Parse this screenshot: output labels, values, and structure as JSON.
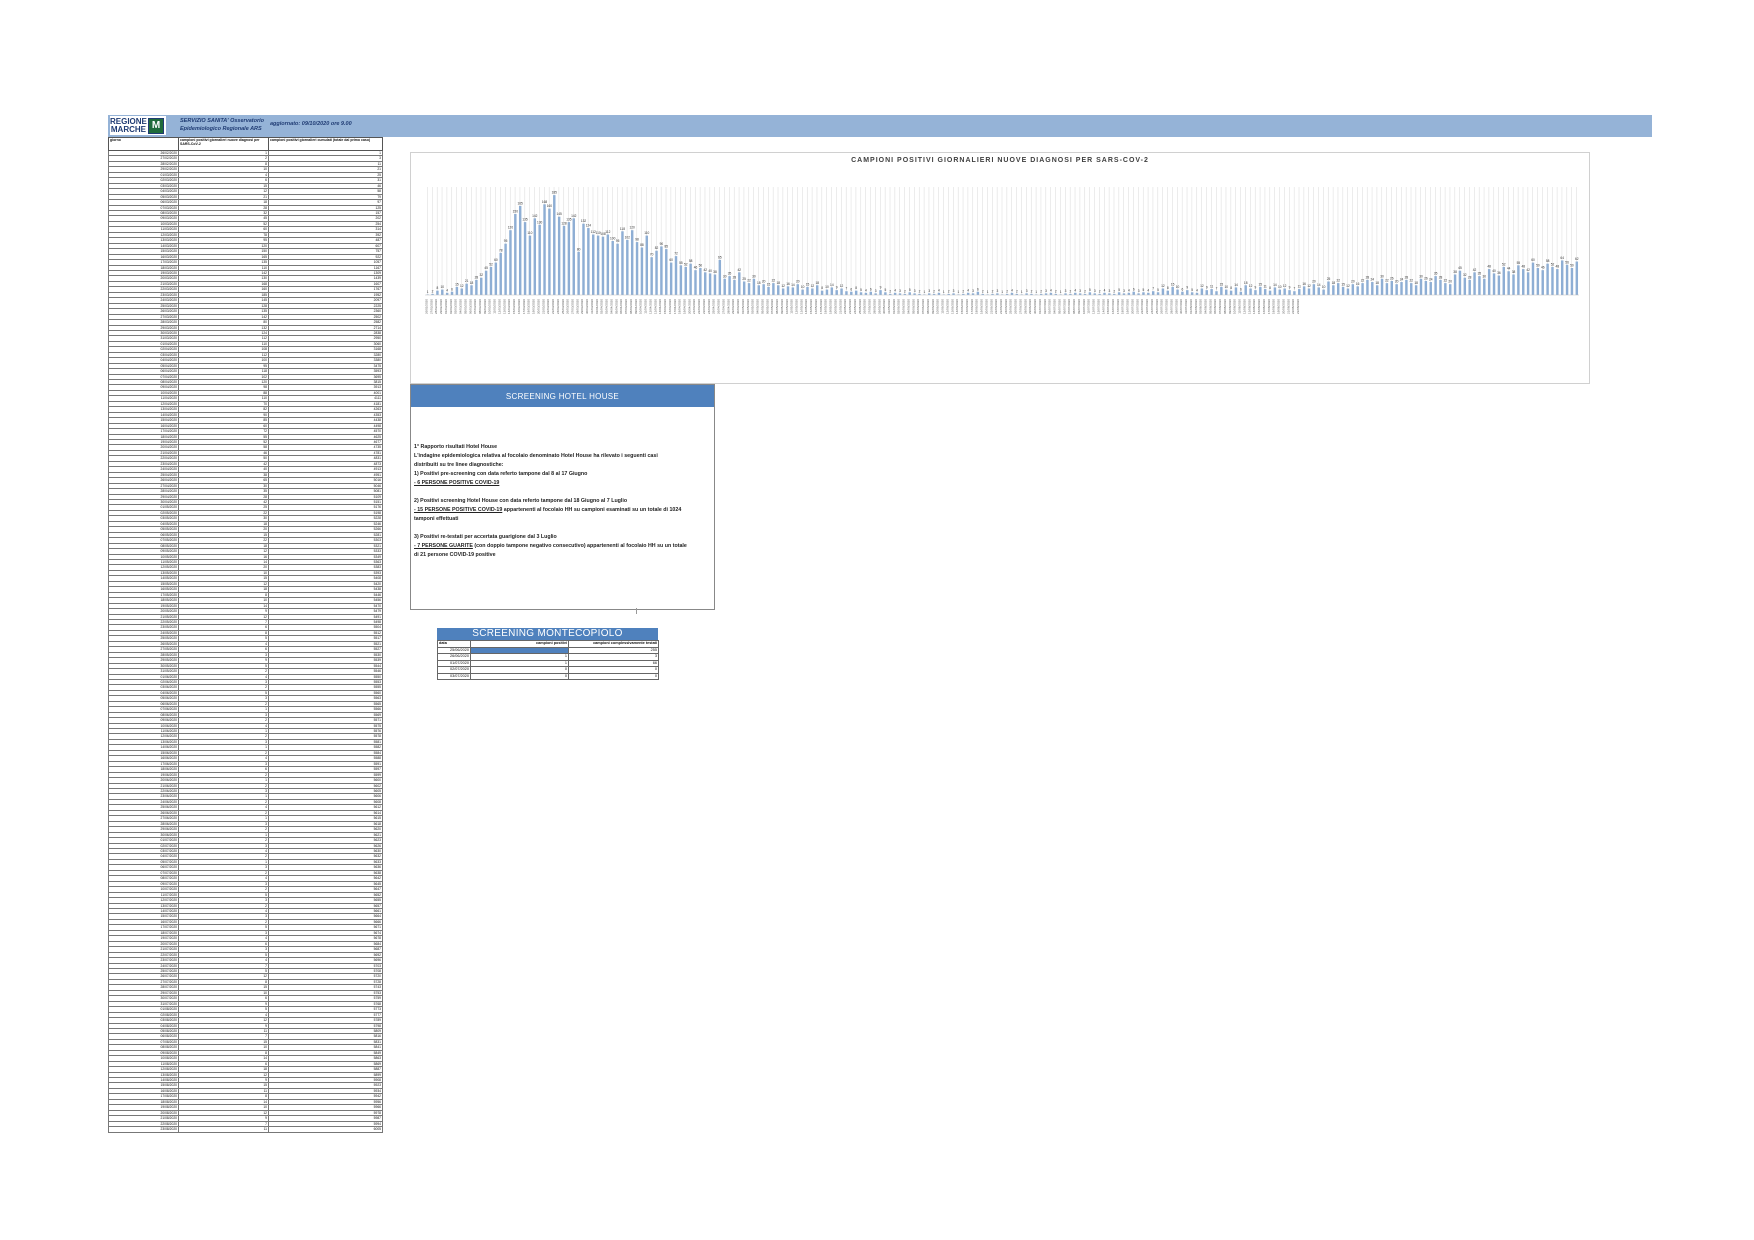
{
  "header": {
    "logo_text": "REGIONE MARCHE",
    "logo_mark": "M",
    "office": "SERVIZIO SANITA' Osservatorio Epidemiologico Regionale ARS",
    "update": "aggiornato: 09/10/2020 ore 9.00"
  },
  "table": {
    "headers": [
      "giorno",
      "campioni positivi giornalieri nuove diagnosi per SARS-CoV-2",
      "campioni positivi giornalieri cumulati (totale dal primo caso)"
    ],
    "rows": [
      [
        "26/02/2020",
        "1",
        "1"
      ],
      [
        "27/02/2020",
        "2",
        "3"
      ],
      [
        "28/02/2020",
        "8",
        "11"
      ],
      [
        "29/02/2020",
        "10",
        "21"
      ],
      [
        "01/03/2020",
        "4",
        "25"
      ],
      [
        "02/03/2020",
        "6",
        "31"
      ],
      [
        "03/03/2020",
        "15",
        "46"
      ],
      [
        "04/03/2020",
        "12",
        "58"
      ],
      [
        "05/03/2020",
        "21",
        "79"
      ],
      [
        "06/03/2020",
        "18",
        "97"
      ],
      [
        "07/03/2020",
        "28",
        "125"
      ],
      [
        "08/03/2020",
        "32",
        "157"
      ],
      [
        "09/03/2020",
        "45",
        "202"
      ],
      [
        "10/03/2020",
        "52",
        "254"
      ],
      [
        "11/03/2020",
        "60",
        "314"
      ],
      [
        "12/03/2020",
        "78",
        "392"
      ],
      [
        "13/03/2020",
        "95",
        "487"
      ],
      [
        "14/03/2020",
        "120",
        "607"
      ],
      [
        "15/03/2020",
        "150",
        "757"
      ],
      [
        "16/03/2020",
        "165",
        "922"
      ],
      [
        "17/03/2020",
        "135",
        "1057"
      ],
      [
        "18/03/2020",
        "110",
        "1167"
      ],
      [
        "19/03/2020",
        "142",
        "1309"
      ],
      [
        "20/03/2020",
        "130",
        "1439"
      ],
      [
        "21/03/2020",
        "168",
        "1607"
      ],
      [
        "22/03/2020",
        "160",
        "1767"
      ],
      [
        "23/03/2020",
        "185",
        "1952"
      ],
      [
        "24/03/2020",
        "145",
        "2097"
      ],
      [
        "25/03/2020",
        "128",
        "2225"
      ],
      [
        "26/03/2020",
        "135",
        "2360"
      ],
      [
        "27/03/2020",
        "142",
        "2502"
      ],
      [
        "28/03/2020",
        "80",
        "2582"
      ],
      [
        "29/03/2020",
        "132",
        "2714"
      ],
      [
        "30/03/2020",
        "124",
        "2838"
      ],
      [
        "31/03/2020",
        "112",
        "2950"
      ],
      [
        "01/04/2020",
        "110",
        "3060"
      ],
      [
        "02/04/2020",
        "108",
        "3168"
      ],
      [
        "03/04/2020",
        "112",
        "3280"
      ],
      [
        "04/04/2020",
        "100",
        "3380"
      ],
      [
        "05/04/2020",
        "95",
        "3475"
      ],
      [
        "06/04/2020",
        "118",
        "3593"
      ],
      [
        "07/04/2020",
        "102",
        "3695"
      ],
      [
        "08/04/2020",
        "120",
        "3815"
      ],
      [
        "09/04/2020",
        "98",
        "3913"
      ],
      [
        "10/04/2020",
        "88",
        "4001"
      ],
      [
        "11/04/2020",
        "110",
        "4111"
      ],
      [
        "12/04/2020",
        "70",
        "4181"
      ],
      [
        "13/04/2020",
        "82",
        "4263"
      ],
      [
        "14/04/2020",
        "90",
        "4353"
      ],
      [
        "15/04/2020",
        "85",
        "4438"
      ],
      [
        "16/04/2020",
        "60",
        "4498"
      ],
      [
        "17/04/2020",
        "72",
        "4570"
      ],
      [
        "18/04/2020",
        "55",
        "4625"
      ],
      [
        "19/04/2020",
        "52",
        "4677"
      ],
      [
        "20/04/2020",
        "58",
        "4735"
      ],
      [
        "21/04/2020",
        "46",
        "4781"
      ],
      [
        "22/04/2020",
        "50",
        "4831"
      ],
      [
        "23/04/2020",
        "42",
        "4873"
      ],
      [
        "24/04/2020",
        "40",
        "4913"
      ],
      [
        "25/04/2020",
        "38",
        "4951"
      ],
      [
        "26/04/2020",
        "65",
        "5016"
      ],
      [
        "27/04/2020",
        "30",
        "5046"
      ],
      [
        "28/04/2020",
        "35",
        "5081"
      ],
      [
        "29/04/2020",
        "28",
        "5109"
      ],
      [
        "30/04/2020",
        "42",
        "5151"
      ],
      [
        "01/05/2020",
        "25",
        "5176"
      ],
      [
        "02/05/2020",
        "22",
        "5198"
      ],
      [
        "03/05/2020",
        "30",
        "5228"
      ],
      [
        "04/05/2020",
        "18",
        "5246"
      ],
      [
        "05/05/2020",
        "20",
        "5266"
      ],
      [
        "06/05/2020",
        "15",
        "5281"
      ],
      [
        "07/05/2020",
        "22",
        "5303"
      ],
      [
        "08/05/2020",
        "18",
        "5321"
      ],
      [
        "09/05/2020",
        "12",
        "5333"
      ],
      [
        "10/05/2020",
        "16",
        "5349"
      ],
      [
        "11/05/2020",
        "14",
        "5363"
      ],
      [
        "12/05/2020",
        "20",
        "5383"
      ],
      [
        "13/05/2020",
        "10",
        "5393"
      ],
      [
        "14/05/2020",
        "15",
        "5408"
      ],
      [
        "15/05/2020",
        "12",
        "5420"
      ],
      [
        "16/05/2020",
        "18",
        "5438"
      ],
      [
        "17/05/2020",
        "8",
        "5446"
      ],
      [
        "18/05/2020",
        "10",
        "5456"
      ],
      [
        "19/05/2020",
        "14",
        "5470"
      ],
      [
        "20/05/2020",
        "9",
        "5479"
      ],
      [
        "21/05/2020",
        "12",
        "5491"
      ],
      [
        "22/05/2020",
        "7",
        "5498"
      ],
      [
        "23/05/2020",
        "6",
        "5504"
      ],
      [
        "24/05/2020",
        "8",
        "5512"
      ],
      [
        "25/05/2020",
        "5",
        "5517"
      ],
      [
        "26/05/2020",
        "4",
        "5521"
      ],
      [
        "27/05/2020",
        "6",
        "5527"
      ],
      [
        "28/05/2020",
        "3",
        "5530"
      ],
      [
        "29/05/2020",
        "9",
        "5539"
      ],
      [
        "30/05/2020",
        "5",
        "5544"
      ],
      [
        "31/05/2020",
        "2",
        "5546"
      ],
      [
        "01/06/2020",
        "4",
        "5550"
      ],
      [
        "02/06/2020",
        "3",
        "5553"
      ],
      [
        "03/06/2020",
        "2",
        "5555"
      ],
      [
        "04/06/2020",
        "5",
        "5560"
      ],
      [
        "05/06/2020",
        "3",
        "5563"
      ],
      [
        "06/06/2020",
        "2",
        "5565"
      ],
      [
        "07/06/2020",
        "1",
        "5566"
      ],
      [
        "08/06/2020",
        "3",
        "5569"
      ],
      [
        "09/06/2020",
        "2",
        "5571"
      ],
      [
        "10/06/2020",
        "4",
        "5575"
      ],
      [
        "11/06/2020",
        "1",
        "5576"
      ],
      [
        "12/06/2020",
        "2",
        "5578"
      ],
      [
        "13/06/2020",
        "3",
        "5581"
      ],
      [
        "14/06/2020",
        "1",
        "5582"
      ],
      [
        "15/06/2020",
        "2",
        "5584"
      ],
      [
        "16/06/2020",
        "4",
        "5588"
      ],
      [
        "17/06/2020",
        "3",
        "5591"
      ],
      [
        "18/06/2020",
        "6",
        "5597"
      ],
      [
        "19/06/2020",
        "2",
        "5599"
      ],
      [
        "20/06/2020",
        "1",
        "5600"
      ],
      [
        "21/06/2020",
        "2",
        "5602"
      ],
      [
        "22/06/2020",
        "3",
        "5605"
      ],
      [
        "23/06/2020",
        "1",
        "5606"
      ],
      [
        "24/06/2020",
        "2",
        "5608"
      ],
      [
        "25/06/2020",
        "4",
        "5612"
      ],
      [
        "26/06/2020",
        "2",
        "5614"
      ],
      [
        "27/06/2020",
        "1",
        "5615"
      ],
      [
        "28/06/2020",
        "3",
        "5618"
      ],
      [
        "29/06/2020",
        "2",
        "5620"
      ],
      [
        "30/06/2020",
        "1",
        "5621"
      ],
      [
        "01/07/2020",
        "2",
        "5623"
      ],
      [
        "02/07/2020",
        "3",
        "5626"
      ],
      [
        "03/07/2020",
        "4",
        "5630"
      ],
      [
        "04/07/2020",
        "2",
        "5632"
      ],
      [
        "05/07/2020",
        "1",
        "5633"
      ],
      [
        "06/07/2020",
        "3",
        "5636"
      ],
      [
        "07/07/2020",
        "2",
        "5638"
      ],
      [
        "08/07/2020",
        "4",
        "5642"
      ],
      [
        "09/07/2020",
        "3",
        "5645"
      ],
      [
        "10/07/2020",
        "2",
        "5647"
      ],
      [
        "11/07/2020",
        "5",
        "5652"
      ],
      [
        "12/07/2020",
        "3",
        "5655"
      ],
      [
        "13/07/2020",
        "2",
        "5657"
      ],
      [
        "14/07/2020",
        "4",
        "5661"
      ],
      [
        "15/07/2020",
        "3",
        "5664"
      ],
      [
        "16/07/2020",
        "2",
        "5666"
      ],
      [
        "17/07/2020",
        "5",
        "5671"
      ],
      [
        "18/07/2020",
        "3",
        "5674"
      ],
      [
        "19/07/2020",
        "4",
        "5678"
      ],
      [
        "20/07/2020",
        "6",
        "5684"
      ],
      [
        "21/07/2020",
        "3",
        "5687"
      ],
      [
        "22/07/2020",
        "5",
        "5692"
      ],
      [
        "23/07/2020",
        "4",
        "5696"
      ],
      [
        "24/07/2020",
        "7",
        "5703"
      ],
      [
        "25/07/2020",
        "5",
        "5708"
      ],
      [
        "26/07/2020",
        "12",
        "5720"
      ],
      [
        "27/07/2020",
        "8",
        "5728"
      ],
      [
        "28/07/2020",
        "15",
        "5743"
      ],
      [
        "29/07/2020",
        "10",
        "5753"
      ],
      [
        "30/07/2020",
        "6",
        "5759"
      ],
      [
        "31/07/2020",
        "9",
        "5768"
      ],
      [
        "01/08/2020",
        "5",
        "5773"
      ],
      [
        "02/08/2020",
        "4",
        "5777"
      ],
      [
        "03/08/2020",
        "12",
        "5789"
      ],
      [
        "04/08/2020",
        "9",
        "5798"
      ],
      [
        "05/08/2020",
        "11",
        "5809"
      ],
      [
        "06/08/2020",
        "7",
        "5816"
      ],
      [
        "07/08/2020",
        "15",
        "5831"
      ],
      [
        "08/08/2020",
        "10",
        "5841"
      ],
      [
        "09/08/2020",
        "8",
        "5849"
      ],
      [
        "10/08/2020",
        "14",
        "5863"
      ],
      [
        "11/08/2020",
        "6",
        "5869"
      ],
      [
        "12/08/2020",
        "18",
        "5887"
      ],
      [
        "13/08/2020",
        "12",
        "5899"
      ],
      [
        "14/08/2020",
        "9",
        "5908"
      ],
      [
        "15/08/2020",
        "15",
        "5923"
      ],
      [
        "16/08/2020",
        "11",
        "5934"
      ],
      [
        "17/08/2020",
        "8",
        "5942"
      ],
      [
        "18/08/2020",
        "14",
        "5956"
      ],
      [
        "19/08/2020",
        "10",
        "5966"
      ],
      [
        "20/08/2020",
        "12",
        "5978"
      ],
      [
        "21/08/2020",
        "9",
        "5987"
      ],
      [
        "22/08/2020",
        "7",
        "5994"
      ],
      [
        "23/08/2020",
        "11",
        "6005"
      ]
    ]
  },
  "chart_data": {
    "type": "bar",
    "title": "CAMPIONI POSITIVI GIORNALIERI NUOVE DIAGNOSI PER SARS-COV-2",
    "ylim": [
      0,
      200
    ],
    "grid": true,
    "series": [
      {
        "values": [
          1,
          2,
          8,
          10,
          4,
          6,
          15,
          12,
          21,
          18,
          28,
          32,
          45,
          52,
          60,
          78,
          95,
          120,
          150,
          165,
          135,
          110,
          142,
          130,
          168,
          160,
          185,
          145,
          128,
          135,
          142,
          80,
          132,
          124,
          112,
          110,
          108,
          112,
          100,
          95,
          118,
          102,
          120,
          98,
          88,
          110,
          70,
          82,
          90,
          85,
          60,
          72,
          55,
          52,
          58,
          46,
          50,
          42,
          40,
          38,
          65,
          30,
          35,
          28,
          42,
          25,
          22,
          30,
          18,
          20,
          15,
          22,
          18,
          12,
          16,
          14,
          20,
          10,
          15,
          12,
          18,
          8,
          10,
          14,
          9,
          12,
          7,
          6,
          8,
          5,
          4,
          6,
          3,
          9,
          5,
          2,
          4,
          3,
          2,
          5,
          3,
          2,
          1,
          3,
          2,
          4,
          1,
          2,
          3,
          1,
          2,
          4,
          3,
          6,
          2,
          1,
          2,
          3,
          1,
          2,
          4,
          2,
          1,
          3,
          2,
          1,
          2,
          3,
          4,
          2,
          1,
          3,
          2,
          4,
          3,
          2,
          5,
          3,
          2,
          4,
          3,
          2,
          5,
          3,
          4,
          6,
          3,
          5,
          4,
          7,
          5,
          12,
          8,
          15,
          10,
          6,
          9,
          5,
          4,
          12,
          9,
          11,
          7,
          15,
          10,
          8,
          14,
          6,
          18,
          12,
          9,
          15,
          11,
          8,
          14,
          10,
          12,
          9,
          7,
          11,
          16,
          12,
          20,
          14,
          10,
          25,
          18,
          22,
          15,
          12,
          20,
          16,
          22,
          28,
          24,
          18,
          30,
          22,
          26,
          20,
          24,
          28,
          22,
          18,
          30,
          26,
          24,
          35,
          28,
          22,
          20,
          38,
          45,
          32,
          28,
          42,
          35,
          30,
          48,
          40,
          36,
          52,
          44,
          38,
          55,
          48,
          42,
          60,
          50,
          46,
          58,
          52,
          48,
          64,
          56,
          50,
          62
        ]
      }
    ]
  },
  "hotel": {
    "title": "SCREENING HOTEL HOUSE",
    "line1": "1° Rapporto risultati Hotel House",
    "line2": "L'indagine epidemiologica relativa al focolaio denominato Hotel House ha rilevato i seguenti casi",
    "line3": "distribuiti su tre linee diagnostiche:",
    "line4": "1) Positivi pre-screening con data referto tampone dal 8 al 17 Giugno",
    "line5": "- 6 PERSONE POSITIVE COVID-19",
    "line6": "2) Positivi screening Hotel House con data referto tampone dal 18 Giugno al 7 Luglio",
    "line7a": "- 15 PERSONE POSITIVE COVID-19",
    "line7b": " appartenenti al focolaio HH su campioni esaminati su un totale di 1024",
    "line8": "tamponi effettuati",
    "line9": "3) Positivi re-testati per accertata guarigione dal 3 Luglio",
    "line10a": "- 7 PERSONE GUARITE",
    "line10b": " (con doppio tampone negativo consecutivo) appartenenti al focolaio HH su un totale",
    "line11": "di 21 persone COVID-19 positive"
  },
  "montecopiolo": {
    "title": "SCREENING MONTECOPIOLO",
    "headers": [
      "data",
      "campioni positivi",
      "campioni complessivamente testati"
    ],
    "rows": [
      [
        "25/06/2020",
        "",
        "255"
      ],
      [
        "26/06/2020",
        "1",
        "3"
      ],
      [
        "01/07/2020",
        "1",
        "66"
      ],
      [
        "02/07/2020",
        "0",
        "0"
      ],
      [
        "03/07/2020",
        "0",
        "0"
      ]
    ]
  }
}
